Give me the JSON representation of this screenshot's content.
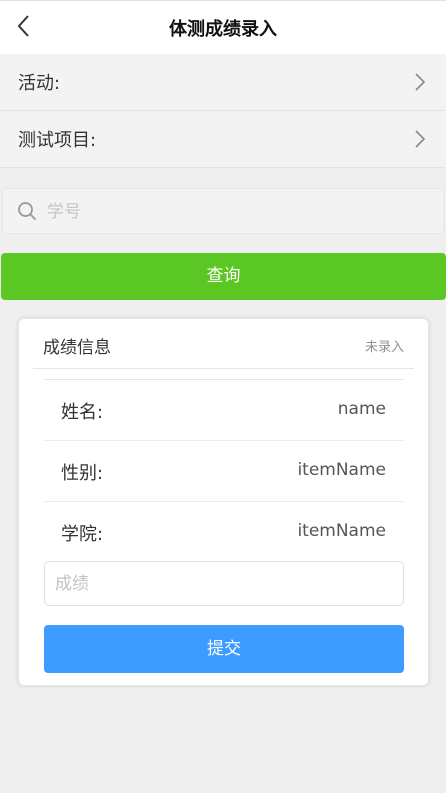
{
  "header": {
    "title": "体测成绩录入",
    "back_icon": "chevron-left-icon"
  },
  "cells": [
    {
      "label": "活动:",
      "icon": "chevron-right-icon"
    },
    {
      "label": "测试项目:",
      "icon": "chevron-right-icon"
    }
  ],
  "search": {
    "placeholder": "学号",
    "value": "",
    "icon": "search-icon"
  },
  "query_button": {
    "label": "查询"
  },
  "card": {
    "title": "成绩信息",
    "status": "未录入",
    "rows": [
      {
        "label": "姓名:",
        "value": "name"
      },
      {
        "label": "性别:",
        "value": "itemName"
      },
      {
        "label": "学院:",
        "value": "itemName"
      }
    ],
    "score_input": {
      "placeholder": "成绩",
      "value": ""
    },
    "submit_label": "提交"
  },
  "colors": {
    "query_button": "#5ac725",
    "submit_button": "#3c9cff",
    "background": "#efefef"
  }
}
